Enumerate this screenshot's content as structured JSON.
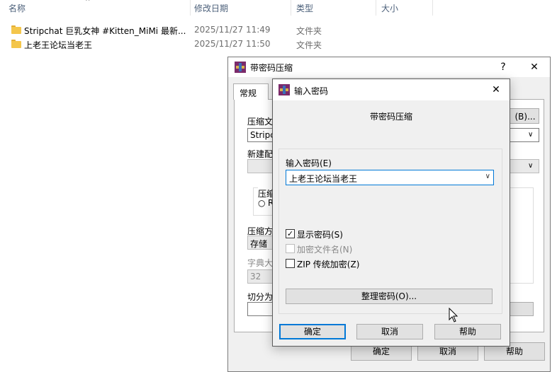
{
  "explorer": {
    "columns": {
      "name": "名称",
      "date": "修改日期",
      "type": "类型",
      "size": "大小"
    },
    "files": [
      {
        "name": "Stripchat 巨乳女神 #Kitten_MiMi 最新...",
        "date": "2025/11/27 11:49",
        "type": "文件夹",
        "icon": "folder-icon"
      },
      {
        "name": "上老王论坛当老王",
        "date": "2025/11/27 11:50",
        "type": "文件夹",
        "icon": "folder-icon"
      }
    ]
  },
  "back_dialog": {
    "title": "带密码压缩",
    "help_glyph": "?",
    "close_glyph": "✕",
    "tab_general": "常规",
    "fragments": {
      "archive_name_label": "压缩文",
      "archive_name_value": "Stripch",
      "browse_button": "(B)...",
      "new_profile_label": "新建配",
      "format_group_label": "压缩",
      "format_radio_fragment": "R",
      "method_label": "压缩方",
      "method_value": "存储",
      "dict_label": "字典大",
      "dict_value": "32",
      "split_label": "切分为"
    },
    "buttons": {
      "ok": "确定",
      "cancel": "取消",
      "help": "帮助"
    }
  },
  "front_dialog": {
    "title": "输入密码",
    "close_glyph": "✕",
    "subtitle": "带密码压缩",
    "password_label": "输入密码(E)",
    "password_value": "上老王论坛当老王",
    "checkboxes": [
      {
        "label": "显示密码(S)",
        "checked": true,
        "enabled": true
      },
      {
        "label": "加密文件名(N)",
        "checked": false,
        "enabled": false
      },
      {
        "label": "ZIP 传统加密(Z)",
        "checked": false,
        "enabled": true
      }
    ],
    "manage_button": "整理密码(O)...",
    "buttons": {
      "ok": "确定",
      "cancel": "取消",
      "help": "帮助"
    }
  },
  "colors": {
    "accent": "#0078d7",
    "folder": "#f4c64b",
    "dialog_bg": "#f0f0f0"
  }
}
